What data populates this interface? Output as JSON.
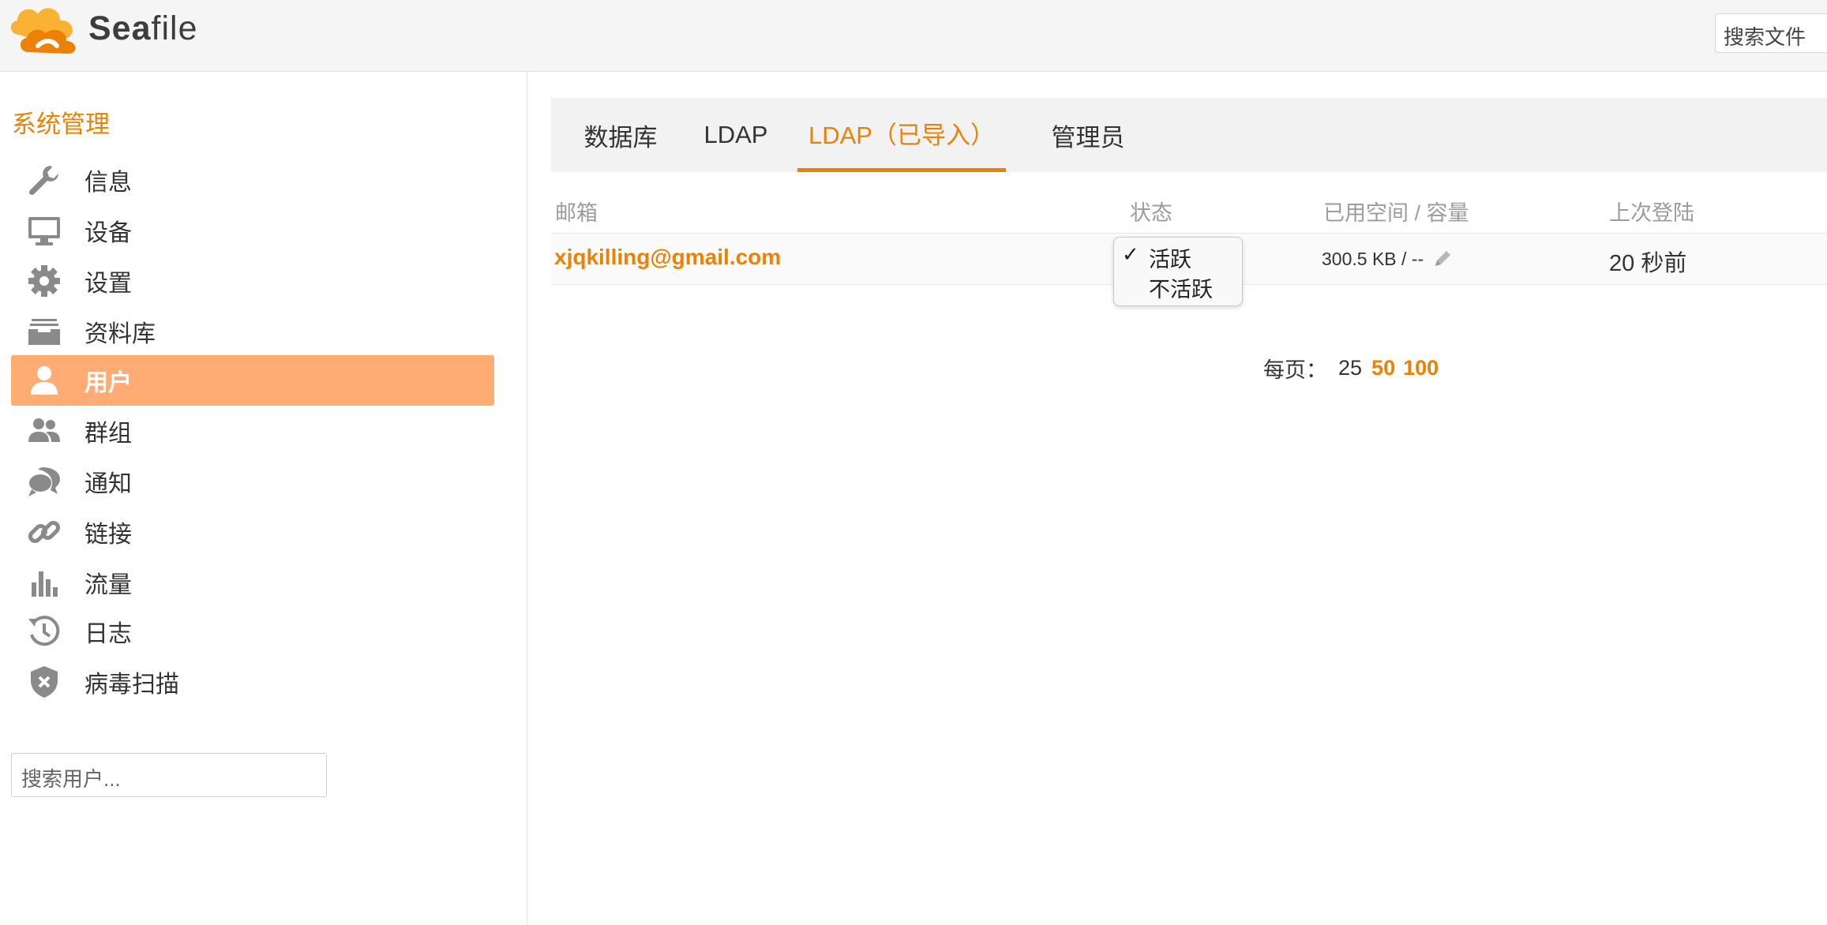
{
  "header": {
    "logo_text_bold": "Sea",
    "logo_text_rest": "file",
    "search_placeholder": "搜索文件"
  },
  "sidebar": {
    "title": "系统管理",
    "items": [
      {
        "label": "信息",
        "icon": "wrench-icon"
      },
      {
        "label": "设备",
        "icon": "monitor-icon"
      },
      {
        "label": "设置",
        "icon": "gear-icon"
      },
      {
        "label": "资料库",
        "icon": "archive-icon"
      },
      {
        "label": "用户",
        "icon": "user-icon",
        "active": true
      },
      {
        "label": "群组",
        "icon": "group-icon"
      },
      {
        "label": "通知",
        "icon": "chat-icon"
      },
      {
        "label": "链接",
        "icon": "link-icon"
      },
      {
        "label": "流量",
        "icon": "bar-chart-icon"
      },
      {
        "label": "日志",
        "icon": "history-icon"
      },
      {
        "label": "病毒扫描",
        "icon": "shield-icon"
      }
    ],
    "search_placeholder": "搜索用户..."
  },
  "tabs": [
    {
      "label": "数据库"
    },
    {
      "label": "LDAP"
    },
    {
      "label": "LDAP（已导入）",
      "active": true
    },
    {
      "label": "管理员"
    }
  ],
  "table": {
    "headers": [
      "邮箱",
      "状态",
      "已用空间 / 容量",
      "上次登陆"
    ],
    "rows": [
      {
        "email": "xjqkilling@gmail.com",
        "space": "300.5 KB / --",
        "last_login": "20 秒前"
      }
    ]
  },
  "status_dropdown": {
    "check": "✓",
    "options": [
      "活跃",
      "不活跃"
    ],
    "selected": "活跃"
  },
  "pagination": {
    "label": "每页：",
    "sizes": [
      "25",
      "50",
      "100"
    ],
    "current": "25"
  },
  "colors": {
    "accent": "#eb8205",
    "active_nav_bg": "#feac74",
    "icon_gray": "#8a8a8a"
  }
}
